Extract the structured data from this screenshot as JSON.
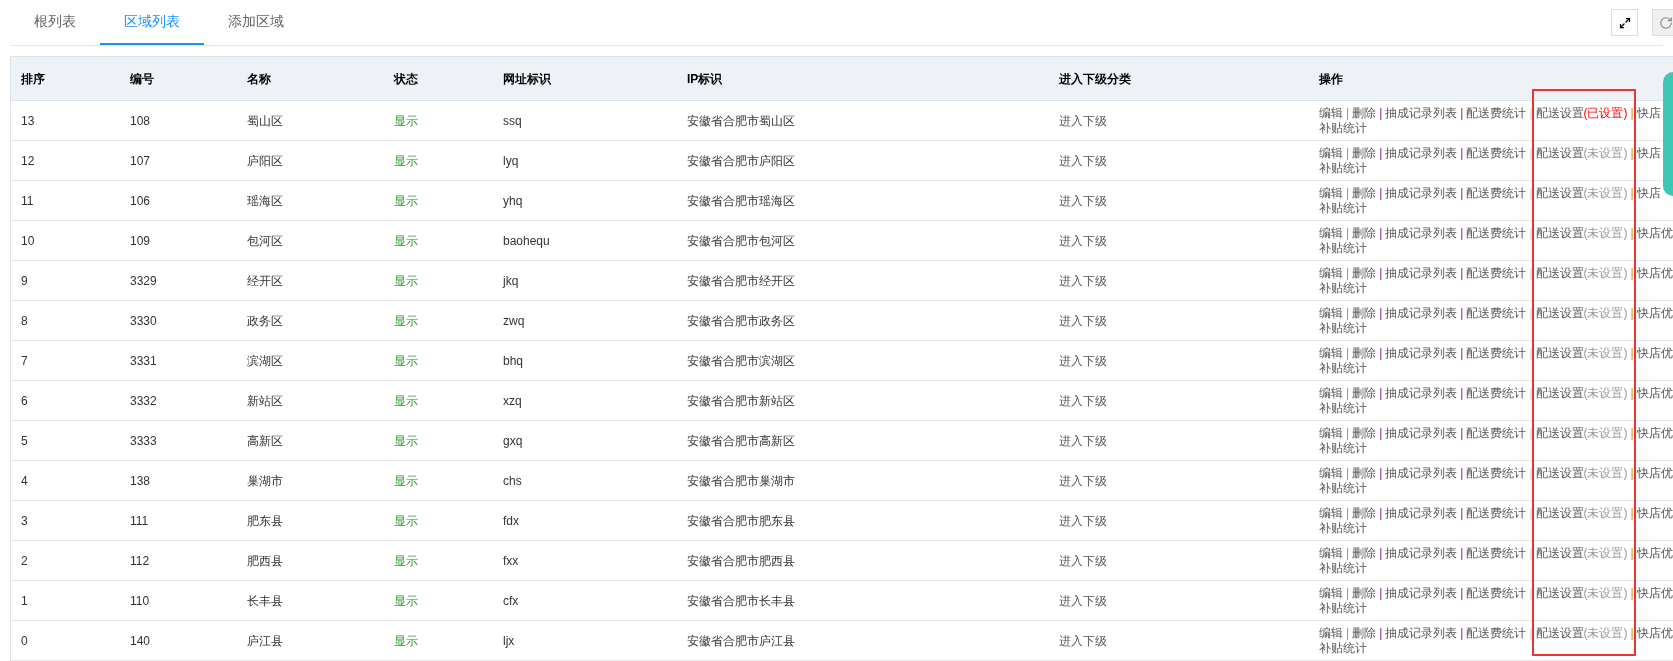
{
  "tabs": [
    {
      "label": "根列表",
      "selected": false
    },
    {
      "label": "区域列表",
      "selected": true
    },
    {
      "label": "添加区域",
      "selected": false
    }
  ],
  "table": {
    "columns": [
      "排序",
      "编号",
      "名称",
      "状态",
      "网址标识",
      "IP标识",
      "进入下级分类",
      "操作"
    ],
    "rows": [
      {
        "order": "13",
        "code": "108",
        "name": "蜀山区",
        "status": "显示",
        "slug": "ssq",
        "ip": "安徽省合肥市蜀山区",
        "sub": "进入下级",
        "actions": [
          "编辑",
          "删除",
          "抽成记录列表",
          "配送费统计"
        ],
        "delivery": "配送设置",
        "delivery_state": "(已设置)",
        "configured": true,
        "more": "快店",
        "line2": "补贴统计"
      },
      {
        "order": "12",
        "code": "107",
        "name": "庐阳区",
        "status": "显示",
        "slug": "lyq",
        "ip": "安徽省合肥市庐阳区",
        "sub": "进入下级",
        "actions": [
          "编辑",
          "删除",
          "抽成记录列表",
          "配送费统计"
        ],
        "delivery": "配送设置",
        "delivery_state": "(未设置)",
        "configured": false,
        "more": "快店",
        "line2": "补贴统计"
      },
      {
        "order": "11",
        "code": "106",
        "name": "瑶海区",
        "status": "显示",
        "slug": "yhq",
        "ip": "安徽省合肥市瑶海区",
        "sub": "进入下级",
        "actions": [
          "编辑",
          "删除",
          "抽成记录列表",
          "配送费统计"
        ],
        "delivery": "配送设置",
        "delivery_state": "(未设置)",
        "configured": false,
        "more": "快店",
        "line2": "补贴统计"
      },
      {
        "order": "10",
        "code": "109",
        "name": "包河区",
        "status": "显示",
        "slug": "baohequ",
        "ip": "安徽省合肥市包河区",
        "sub": "进入下级",
        "actions": [
          "编辑",
          "删除",
          "抽成记录列表",
          "配送费统计"
        ],
        "delivery": "配送设置",
        "delivery_state": "(未设置)",
        "configured": false,
        "more": "快店优",
        "line2": "补贴统计"
      },
      {
        "order": "9",
        "code": "3329",
        "name": "经开区",
        "status": "显示",
        "slug": "jkq",
        "ip": "安徽省合肥市经开区",
        "sub": "进入下级",
        "actions": [
          "编辑",
          "删除",
          "抽成记录列表",
          "配送费统计"
        ],
        "delivery": "配送设置",
        "delivery_state": "(未设置)",
        "configured": false,
        "more": "快店优",
        "line2": "补贴统计"
      },
      {
        "order": "8",
        "code": "3330",
        "name": "政务区",
        "status": "显示",
        "slug": "zwq",
        "ip": "安徽省合肥市政务区",
        "sub": "进入下级",
        "actions": [
          "编辑",
          "删除",
          "抽成记录列表",
          "配送费统计"
        ],
        "delivery": "配送设置",
        "delivery_state": "(未设置)",
        "configured": false,
        "more": "快店优",
        "line2": "补贴统计"
      },
      {
        "order": "7",
        "code": "3331",
        "name": "滨湖区",
        "status": "显示",
        "slug": "bhq",
        "ip": "安徽省合肥市滨湖区",
        "sub": "进入下级",
        "actions": [
          "编辑",
          "删除",
          "抽成记录列表",
          "配送费统计"
        ],
        "delivery": "配送设置",
        "delivery_state": "(未设置)",
        "configured": false,
        "more": "快店优",
        "line2": "补贴统计"
      },
      {
        "order": "6",
        "code": "3332",
        "name": "新站区",
        "status": "显示",
        "slug": "xzq",
        "ip": "安徽省合肥市新站区",
        "sub": "进入下级",
        "actions": [
          "编辑",
          "删除",
          "抽成记录列表",
          "配送费统计"
        ],
        "delivery": "配送设置",
        "delivery_state": "(未设置)",
        "configured": false,
        "more": "快店优",
        "line2": "补贴统计"
      },
      {
        "order": "5",
        "code": "3333",
        "name": "高新区",
        "status": "显示",
        "slug": "gxq",
        "ip": "安徽省合肥市高新区",
        "sub": "进入下级",
        "actions": [
          "编辑",
          "删除",
          "抽成记录列表",
          "配送费统计"
        ],
        "delivery": "配送设置",
        "delivery_state": "(未设置)",
        "configured": false,
        "more": "快店优",
        "line2": "补贴统计"
      },
      {
        "order": "4",
        "code": "138",
        "name": "巢湖市",
        "status": "显示",
        "slug": "chs",
        "ip": "安徽省合肥市巢湖市",
        "sub": "进入下级",
        "actions": [
          "编辑",
          "删除",
          "抽成记录列表",
          "配送费统计"
        ],
        "delivery": "配送设置",
        "delivery_state": "(未设置)",
        "configured": false,
        "more": "快店优",
        "line2": "补贴统计"
      },
      {
        "order": "3",
        "code": "111",
        "name": "肥东县",
        "status": "显示",
        "slug": "fdx",
        "ip": "安徽省合肥市肥东县",
        "sub": "进入下级",
        "actions": [
          "编辑",
          "删除",
          "抽成记录列表",
          "配送费统计"
        ],
        "delivery": "配送设置",
        "delivery_state": "(未设置)",
        "configured": false,
        "more": "快店优",
        "line2": "补贴统计"
      },
      {
        "order": "2",
        "code": "112",
        "name": "肥西县",
        "status": "显示",
        "slug": "fxx",
        "ip": "安徽省合肥市肥西县",
        "sub": "进入下级",
        "actions": [
          "编辑",
          "删除",
          "抽成记录列表",
          "配送费统计"
        ],
        "delivery": "配送设置",
        "delivery_state": "(未设置)",
        "configured": false,
        "more": "快店优",
        "line2": "补贴统计"
      },
      {
        "order": "1",
        "code": "110",
        "name": "长丰县",
        "status": "显示",
        "slug": "cfx",
        "ip": "安徽省合肥市长丰县",
        "sub": "进入下级",
        "actions": [
          "编辑",
          "删除",
          "抽成记录列表",
          "配送费统计"
        ],
        "delivery": "配送设置",
        "delivery_state": "(未设置)",
        "configured": false,
        "more": "快店优",
        "line2": "补贴统计"
      },
      {
        "order": "0",
        "code": "140",
        "name": "庐江县",
        "status": "显示",
        "slug": "ljx",
        "ip": "安徽省合肥市庐江县",
        "sub": "进入下级",
        "actions": [
          "编辑",
          "删除",
          "抽成记录列表",
          "配送费统计"
        ],
        "delivery": "配送设置",
        "delivery_state": "(未设置)",
        "configured": false,
        "more": "快店优",
        "line2": "补贴统计"
      }
    ]
  },
  "separator": "|"
}
